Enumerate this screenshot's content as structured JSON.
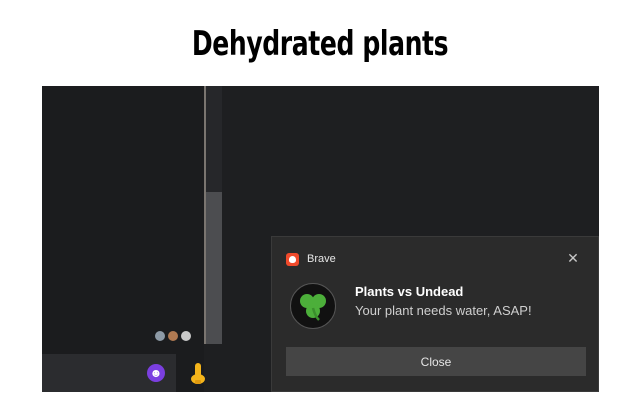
{
  "meme": {
    "title": "Dehydrated plants"
  },
  "notification": {
    "app_name": "Brave",
    "title": "Plants vs Undead",
    "body": "Your plant needs water, ASAP!",
    "close_button_label": "Close",
    "dismiss_icon": "close-icon",
    "image_icon": "clover-icon",
    "app_icon": "brave-logo-icon"
  },
  "chat": {
    "composer_icons": [
      "emoji-icon",
      "thumbs-up-icon"
    ],
    "reaction_avatar_icons": [
      "avatar-icon",
      "avatar-icon",
      "avatar-icon"
    ]
  },
  "colors": {
    "window_bg": "#1e1f21",
    "toast_bg": "#2b2b2b",
    "button_bg": "#454545",
    "brave_orange": "#f04a2b",
    "clover_green": "#4caf3a",
    "emoji_purple": "#7b3fe0",
    "thumb_yellow": "#f5b51b"
  }
}
